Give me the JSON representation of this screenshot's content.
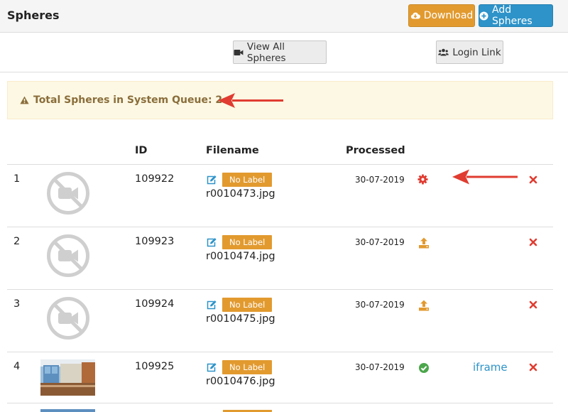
{
  "header": {
    "title": "Spheres",
    "download_label": "Download",
    "add_label": "Add Spheres"
  },
  "toolbar": {
    "view_all_label": "View All Spheres",
    "login_link_label": "Login Link"
  },
  "alert": {
    "text": "Total Spheres in System Queue: 2"
  },
  "table": {
    "columns": [
      "",
      "",
      "ID",
      "Filename",
      "Processed",
      "",
      "",
      ""
    ],
    "rows": [
      {
        "num": "1",
        "thumbnail": "no-video-icon",
        "id": "109922",
        "label": "No Label",
        "filename": "r0010473.jpg",
        "processed": "30-07-2019",
        "status": "gear-icon",
        "link": ""
      },
      {
        "num": "2",
        "thumbnail": "no-video-icon",
        "id": "109923",
        "label": "No Label",
        "filename": "r0010474.jpg",
        "processed": "30-07-2019",
        "status": "upload-icon",
        "link": ""
      },
      {
        "num": "3",
        "thumbnail": "no-video-icon",
        "id": "109924",
        "label": "No Label",
        "filename": "r0010475.jpg",
        "processed": "30-07-2019",
        "status": "upload-icon",
        "link": ""
      },
      {
        "num": "4",
        "thumbnail": "photo",
        "id": "109925",
        "label": "No Label",
        "filename": "r0010476.jpg",
        "processed": "30-07-2019",
        "status": "check-circle-icon",
        "link": "iframe"
      }
    ]
  },
  "colors": {
    "orange": "#e29a2f",
    "blue": "#2d93c9",
    "red": "#e03c31",
    "green": "#4ca64c",
    "alert_bg": "#fcf8e3",
    "alert_text": "#8a6d3b"
  }
}
